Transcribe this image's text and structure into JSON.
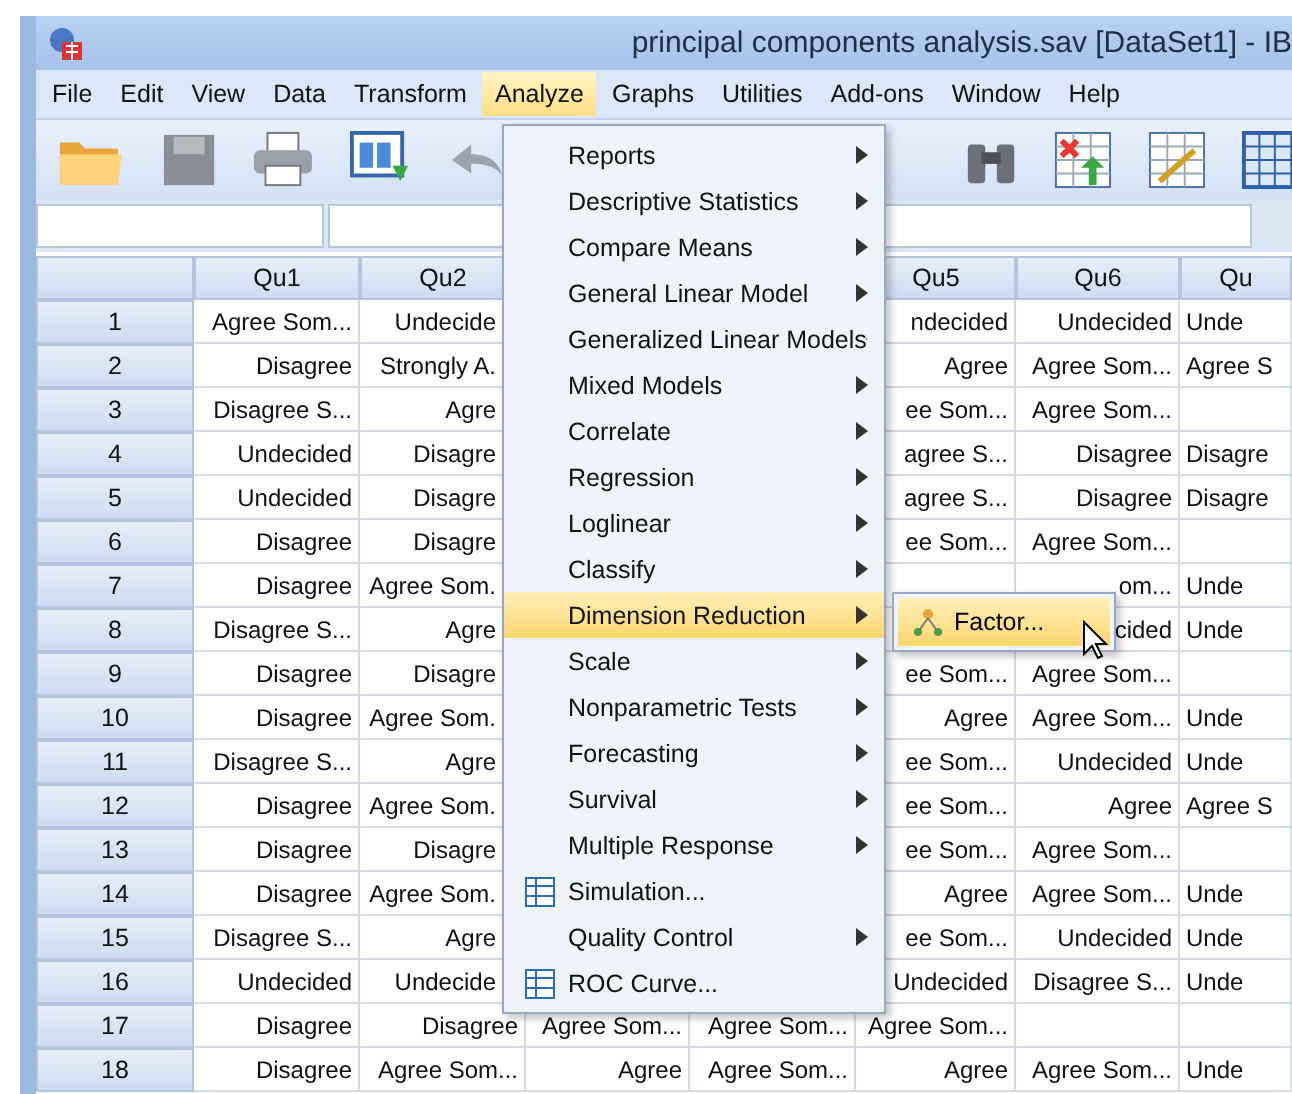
{
  "window": {
    "title": "principal components analysis.sav [DataSet1] - IB"
  },
  "menu_bar": [
    {
      "label": "File",
      "selected": false
    },
    {
      "label": "Edit",
      "selected": false
    },
    {
      "label": "View",
      "selected": false
    },
    {
      "label": "Data",
      "selected": false
    },
    {
      "label": "Transform",
      "selected": false
    },
    {
      "label": "Analyze",
      "selected": true
    },
    {
      "label": "Graphs",
      "selected": false
    },
    {
      "label": "Utilities",
      "selected": false
    },
    {
      "label": "Add-ons",
      "selected": false
    },
    {
      "label": "Window",
      "selected": false
    },
    {
      "label": "Help",
      "selected": false
    }
  ],
  "table": {
    "columns": [
      "Qu1",
      "Qu2",
      null,
      null,
      "Qu5",
      "Qu6",
      "Qu"
    ],
    "rows": [
      {
        "number": "1",
        "cells": [
          "Agree Som...",
          "Undecide",
          null,
          null,
          "ndecided",
          "Undecided",
          "Unde"
        ]
      },
      {
        "number": "2",
        "cells": [
          "Disagree",
          "Strongly A.",
          null,
          null,
          "Agree",
          "Agree Som...",
          "Agree S"
        ]
      },
      {
        "number": "3",
        "cells": [
          "Disagree S...",
          "Agre",
          null,
          null,
          "ee Som...",
          "Agree Som...",
          null
        ]
      },
      {
        "number": "4",
        "cells": [
          "Undecided",
          "Disagre",
          null,
          null,
          "agree S...",
          "Disagree",
          "Disagre"
        ]
      },
      {
        "number": "5",
        "cells": [
          "Undecided",
          "Disagre",
          null,
          null,
          "agree S...",
          "Disagree",
          "Disagre"
        ]
      },
      {
        "number": "6",
        "cells": [
          "Disagree",
          "Disagre",
          null,
          null,
          "ee Som...",
          "Agree Som...",
          null
        ]
      },
      {
        "number": "7",
        "cells": [
          "Disagree",
          "Agree Som.",
          null,
          null,
          null,
          "om...",
          "Unde"
        ]
      },
      {
        "number": "8",
        "cells": [
          "Disagree S...",
          "Agre",
          null,
          null,
          null,
          "cided",
          "Unde"
        ]
      },
      {
        "number": "9",
        "cells": [
          "Disagree",
          "Disagre",
          null,
          null,
          "ee Som...",
          "Agree Som...",
          null
        ]
      },
      {
        "number": "10",
        "cells": [
          "Disagree",
          "Agree Som.",
          null,
          null,
          "Agree",
          "Agree Som...",
          "Unde"
        ]
      },
      {
        "number": "11",
        "cells": [
          "Disagree S...",
          "Agre",
          null,
          null,
          "ee Som...",
          "Undecided",
          "Unde"
        ]
      },
      {
        "number": "12",
        "cells": [
          "Disagree",
          "Agree Som.",
          null,
          null,
          "ee Som...",
          "Agree",
          "Agree S"
        ]
      },
      {
        "number": "13",
        "cells": [
          "Disagree",
          "Disagre",
          null,
          null,
          "ee Som...",
          "Agree Som...",
          null
        ]
      },
      {
        "number": "14",
        "cells": [
          "Disagree",
          "Agree Som.",
          null,
          null,
          "Agree",
          "Agree Som...",
          "Unde"
        ]
      },
      {
        "number": "15",
        "cells": [
          "Disagree S...",
          "Agre",
          null,
          null,
          "ee Som...",
          "Undecided",
          "Unde"
        ]
      },
      {
        "number": "16",
        "cells": [
          "Undecided",
          "Undecide",
          null,
          null,
          "Undecided",
          "Disagree S...",
          "Unde"
        ]
      },
      {
        "number": "17",
        "cells": [
          "Disagree",
          "Disagree",
          "Agree Som...",
          "Agree Som...",
          "Agree Som...",
          null,
          null
        ]
      },
      {
        "number": "18",
        "cells": [
          "Disagree",
          "Agree Som...",
          "Agree",
          "Agree Som...",
          "Agree",
          "Agree Som...",
          "Unde"
        ]
      }
    ]
  },
  "analyze_menu": {
    "items": [
      {
        "label": "Reports",
        "kind": "submenu",
        "selected": false
      },
      {
        "label": "Descriptive Statistics",
        "kind": "submenu",
        "selected": false
      },
      {
        "label": "Compare Means",
        "kind": "submenu",
        "selected": false
      },
      {
        "label": "General Linear Model",
        "kind": "submenu",
        "selected": false
      },
      {
        "label": "Generalized Linear Models",
        "kind": "submenu",
        "selected": false
      },
      {
        "label": "Mixed Models",
        "kind": "submenu",
        "selected": false
      },
      {
        "label": "Correlate",
        "kind": "submenu",
        "selected": false
      },
      {
        "label": "Regression",
        "kind": "submenu",
        "selected": false
      },
      {
        "label": "Loglinear",
        "kind": "submenu",
        "selected": false
      },
      {
        "label": "Classify",
        "kind": "submenu",
        "selected": false
      },
      {
        "label": "Dimension Reduction",
        "kind": "submenu",
        "selected": true
      },
      {
        "label": "Scale",
        "kind": "submenu",
        "selected": false
      },
      {
        "label": "Nonparametric Tests",
        "kind": "submenu",
        "selected": false
      },
      {
        "label": "Forecasting",
        "kind": "submenu",
        "selected": false
      },
      {
        "label": "Survival",
        "kind": "submenu",
        "selected": false
      },
      {
        "label": "Multiple Response",
        "kind": "submenu",
        "selected": false
      },
      {
        "label": "Simulation...",
        "kind": "action",
        "selected": false
      },
      {
        "label": "Quality Control",
        "kind": "submenu",
        "selected": false
      },
      {
        "label": "ROC Curve...",
        "kind": "action",
        "selected": false
      }
    ]
  },
  "dimension_submenu": {
    "items": [
      {
        "label": "Factor...",
        "selected": true
      }
    ]
  }
}
